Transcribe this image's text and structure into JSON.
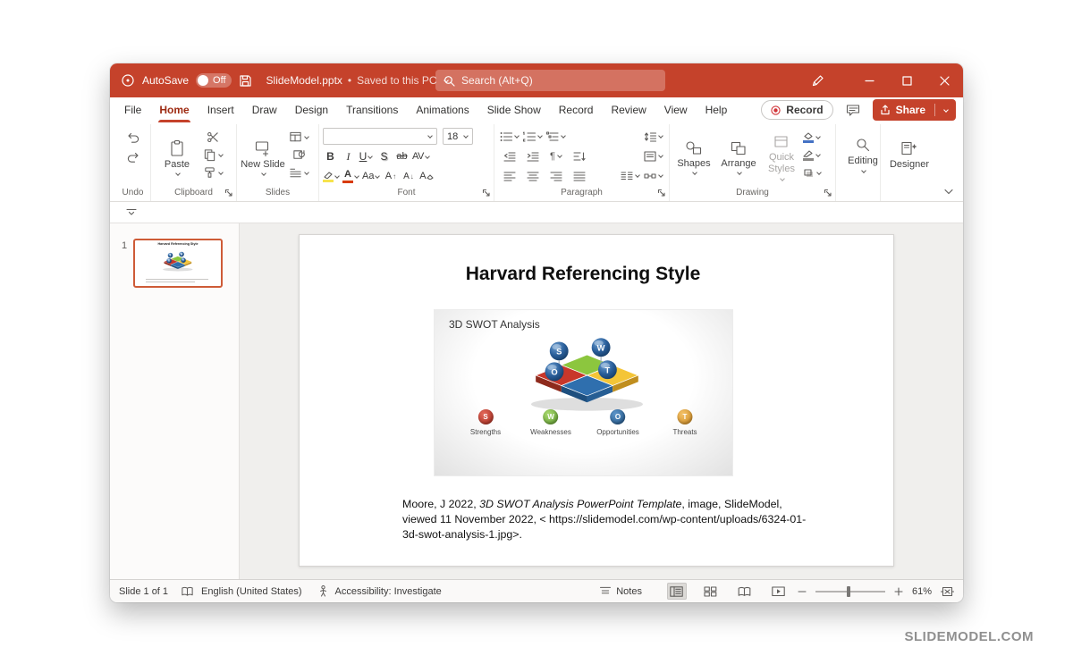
{
  "watermark": "SLIDEMODEL.COM",
  "colors": {
    "titlebar": "#C5422B",
    "share_button": "#C5422B",
    "tab_underline": "#C5422B",
    "thumbnail_selection": "#CE5B37",
    "swot_red": "#C8372B",
    "swot_green": "#8CC63E",
    "swot_blue": "#2F6FAE",
    "swot_yellow": "#F4C537"
  },
  "titlebar": {
    "autosave_label": "AutoSave",
    "autosave_state": "Off",
    "file_title": "SlideModel.pptx",
    "separator": "•",
    "saved_status": "Saved to this PC",
    "search_placeholder": "Search (Alt+Q)"
  },
  "menubar": {
    "tabs": [
      "File",
      "Home",
      "Insert",
      "Draw",
      "Design",
      "Transitions",
      "Animations",
      "Slide Show",
      "Record",
      "Review",
      "View",
      "Help"
    ],
    "active_tab": "Home",
    "record_label": "Record",
    "share_label": "Share"
  },
  "ribbon": {
    "groups": {
      "undo": "Undo",
      "clipboard": "Clipboard",
      "slides": "Slides",
      "font": "Font",
      "paragraph": "Paragraph",
      "drawing": "Drawing"
    },
    "buttons": {
      "paste": "Paste",
      "new_slide": "New Slide",
      "shapes": "Shapes",
      "arrange": "Arrange",
      "quick_styles": "Quick Styles",
      "editing": "Editing",
      "designer": "Designer"
    },
    "font": {
      "size": "18",
      "bold": "B",
      "italic": "I",
      "underline": "U",
      "shadow": "S",
      "strikethrough": "ab",
      "spacing": "AV",
      "case": "Aa",
      "color": "A",
      "grow": "A",
      "shrink": "A",
      "clear": "A"
    }
  },
  "thumbnails": {
    "slide_number": "1"
  },
  "slide": {
    "title": "Harvard Referencing Style",
    "image": {
      "caption": "3D SWOT Analysis",
      "markers": [
        "S",
        "W",
        "O",
        "T"
      ],
      "legend": [
        {
          "letter": "S",
          "label": "Strengths",
          "color": "#C8372B"
        },
        {
          "letter": "W",
          "label": "Weaknesses",
          "color": "#7DBB42"
        },
        {
          "letter": "O",
          "label": "Opportunities",
          "color": "#2E6FAD"
        },
        {
          "letter": "T",
          "label": "Threats",
          "color": "#E9A63C"
        }
      ]
    },
    "citation": {
      "part1": "Moore, J 2022, ",
      "italic": "3D SWOT Analysis PowerPoint Template",
      "part2": ", image, SlideModel, viewed 11 November 2022, < https://slidemodel.com/wp-content/uploads/6324-01-3d-swot-analysis-1.jpg>."
    }
  },
  "statusbar": {
    "slide_info": "Slide 1 of 1",
    "language": "English (United States)",
    "accessibility": "Accessibility: Investigate",
    "notes_label": "Notes",
    "zoom_level": "61%"
  }
}
